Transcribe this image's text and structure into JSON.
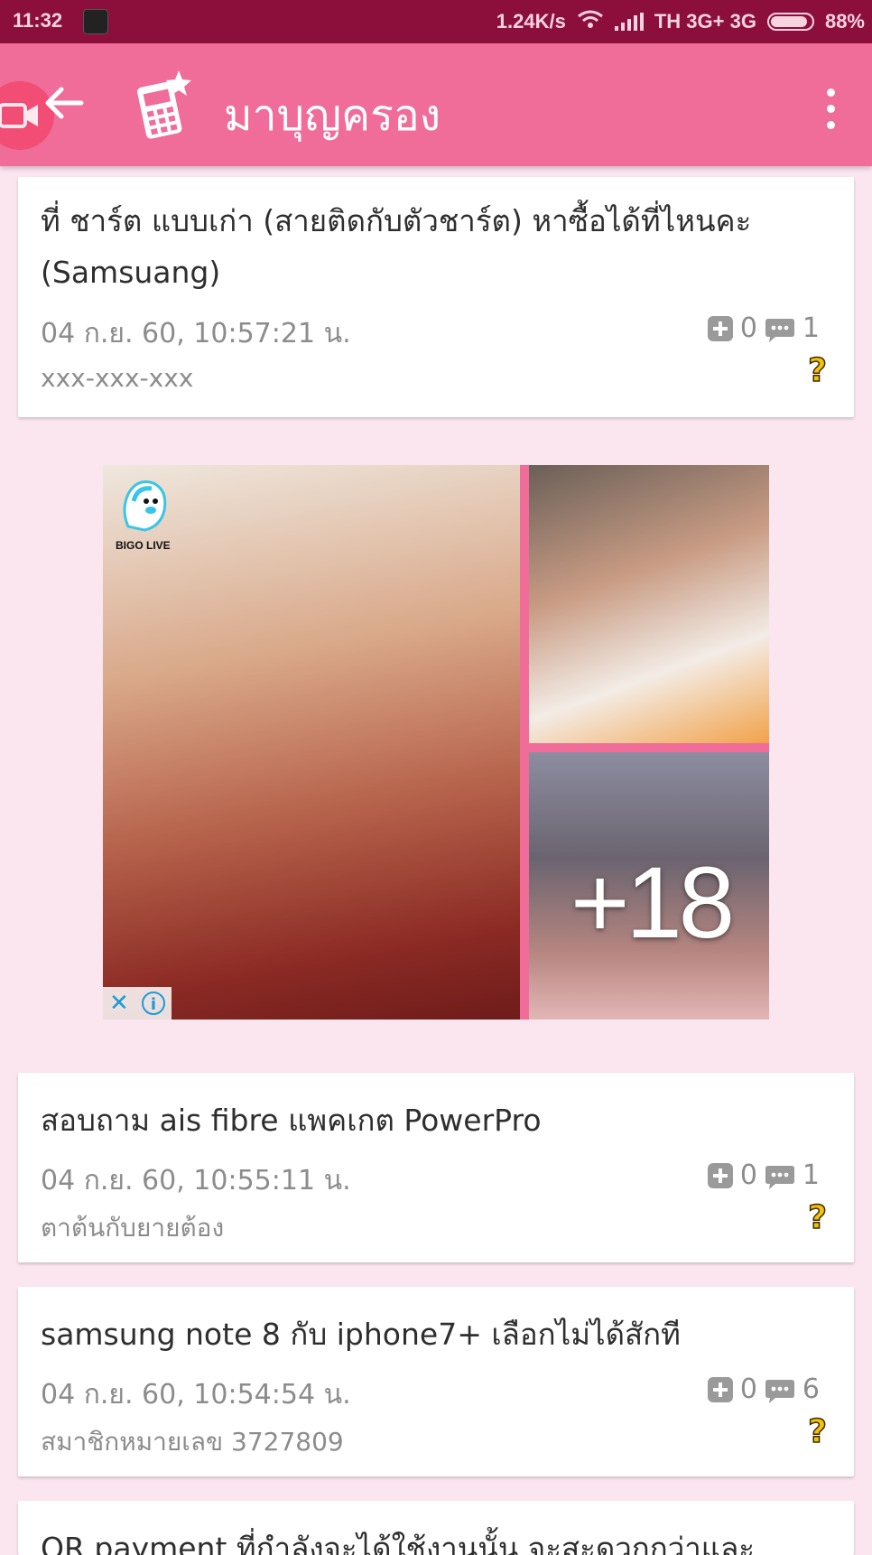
{
  "status_bar": {
    "time": "11:32",
    "net_speed": "1.24K/s",
    "carrier": "TH 3G+ 3G",
    "battery": "88%"
  },
  "app_bar": {
    "title": "มาบุญครอง",
    "icons": [
      "video-camera-icon",
      "back-arrow-icon",
      "phone-star-logo-icon",
      "more-vert-icon"
    ]
  },
  "posts": [
    {
      "title": "ที่ ชาร์ต แบบเก่า (สายติดกับตัวชาร์ต) หาซื้อได้ที่ไหนคะ (Samsuang)",
      "date": "04 ก.ย. 60,  10:57:21 น.",
      "user": "xxx-xxx-xxx",
      "plus_count": "0",
      "comment_count": "1"
    },
    {
      "title": "สอบถาม ais fibre แพคเกต PowerPro",
      "date": "04 ก.ย. 60,  10:55:11 น.",
      "user": "ตาต้นกับยายต้อง",
      "plus_count": "0",
      "comment_count": "1"
    },
    {
      "title": "samsung note 8 กับ iphone7+ เลือกไม่ได้สักที",
      "date": "04 ก.ย. 60,  10:54:54 น.",
      "user": "สมาชิกหมายเลข 3727809",
      "plus_count": "0",
      "comment_count": "6"
    },
    {
      "title": "QR payment ที่กำลังจะได้ใช้งานนั้น จะสะดวกกว่าและ"
    }
  ],
  "ad": {
    "brand": "BIGO LIVE",
    "badge": "+18",
    "close_glyph": "✕",
    "info_glyph": "i"
  },
  "question_mark": "?"
}
